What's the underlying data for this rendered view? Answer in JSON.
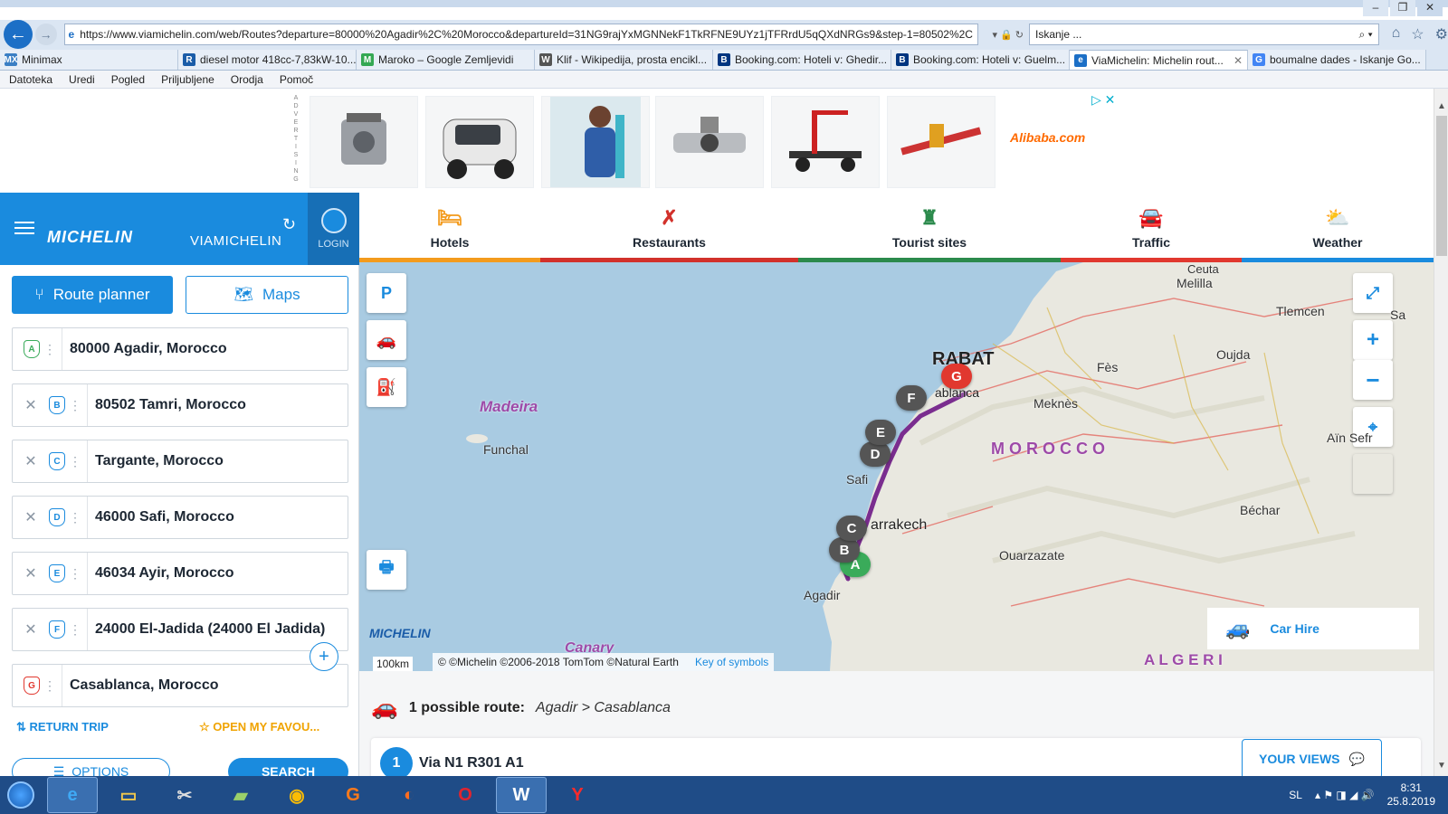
{
  "browser": {
    "url": "https://www.viamichelin.com/web/Routes?departure=80000%20Agadir%2C%20Morocco&departureId=31NG9rajYxMGNNekF1TkRFNE9UYz1jTFRrdU5qQXdNRGs9&step-1=80502%2C",
    "search_placeholder": "Iskanje ...",
    "tabs": [
      {
        "label": "Minimax",
        "fav": "MX",
        "color": "#3b7fc4"
      },
      {
        "label": "diesel motor 418cc-7,83kW-10...",
        "fav": "R",
        "color": "#1a5ca8"
      },
      {
        "label": "Maroko – Google Zemljevidi",
        "fav": "M",
        "color": "#34a853"
      },
      {
        "label": "Klif - Wikipedija, prosta encikl...",
        "fav": "W",
        "color": "#555555"
      },
      {
        "label": "Booking.com: Hoteli v: Ghedir...",
        "fav": "B",
        "color": "#003580"
      },
      {
        "label": "Booking.com: Hoteli v: Guelm...",
        "fav": "B",
        "color": "#003580"
      },
      {
        "label": "ViaMichelin: Michelin rout...",
        "fav": "e",
        "color": "#1c6fc6",
        "active": true
      },
      {
        "label": "boumalne dades - Iskanje Go...",
        "fav": "G",
        "color": "#4285f4"
      }
    ],
    "menu": [
      "Datoteka",
      "Uredi",
      "Pogled",
      "Priljubljene",
      "Orodja",
      "Pomoč"
    ]
  },
  "ads": {
    "label": "ADVERTISING",
    "alibaba": "Alibaba.com"
  },
  "header": {
    "brand": "MICHELIN",
    "product": "VIAMICHELIN",
    "login": "LOGIN"
  },
  "sidebar": {
    "route_planner": "Route planner",
    "maps": "Maps",
    "waypoints": [
      {
        "letter": "A",
        "value": "80000 Agadir, Morocco"
      },
      {
        "letter": "B",
        "value": "80502 Tamri, Morocco"
      },
      {
        "letter": "C",
        "value": "Targante, Morocco"
      },
      {
        "letter": "D",
        "value": "46000 Safi, Morocco"
      },
      {
        "letter": "E",
        "value": "46034 Ayir, Morocco"
      },
      {
        "letter": "F",
        "value": "24000 El-Jadida (24000 El Jadida)"
      },
      {
        "letter": "G",
        "value": "Casablanca, Morocco"
      }
    ],
    "return_trip": "RETURN TRIP",
    "favourites": "OPEN MY FAVOU...",
    "options": "OPTIONS",
    "search": "SEARCH"
  },
  "categories": [
    {
      "label": "Hotels",
      "color": "#f39b1d",
      "icon": "bed-icon"
    },
    {
      "label": "Restaurants",
      "color": "#d2312b",
      "icon": "fork-knife-icon"
    },
    {
      "label": "Tourist sites",
      "color": "#2b8a4c",
      "icon": "castle-icon"
    },
    {
      "label": "Traffic",
      "color": "#e1382f",
      "icon": "car-icon"
    },
    {
      "label": "Weather",
      "color": "#1a8bde",
      "icon": "cloud-sun-icon"
    }
  ],
  "map": {
    "places": {
      "ceuta": "Ceuta",
      "melilla": "Melilla",
      "tlemcen": "Tlemcen",
      "sa": "Sa",
      "rabat": "RABAT",
      "oujda": "Oujda",
      "fes": "Fès",
      "meknes": "Meknès",
      "madeira": "Madeira",
      "funchal": "Funchal",
      "morocco": "M O R O C C O",
      "safi": "Safi",
      "marrakech": "arrakech",
      "ainsefra": "Aïn Sefr",
      "bechar": "Béchar",
      "ouarzazate": "Ouarzazate",
      "agadir": "Agadir",
      "canary": "Canary",
      "algeria": "A L G E R I",
      "casablanca": "ablanca"
    },
    "markers": [
      "A",
      "B",
      "C",
      "D",
      "E",
      "F",
      "G"
    ],
    "scale": "100km",
    "copyright": "© ©Michelin ©2006-2018 TomTom ©Natural Earth",
    "key": "Key of symbols",
    "car_hire": "Car Hire",
    "logo": "MICHELIN"
  },
  "result": {
    "count_label": "1 possible route:",
    "route": "Agadir > Casablanca",
    "num": "1",
    "via": "Via N1 R301 A1",
    "your_views": "YOUR VIEWS"
  },
  "taskbar": {
    "lang": "SL",
    "time": "8:31",
    "date": "25.8.2019"
  }
}
